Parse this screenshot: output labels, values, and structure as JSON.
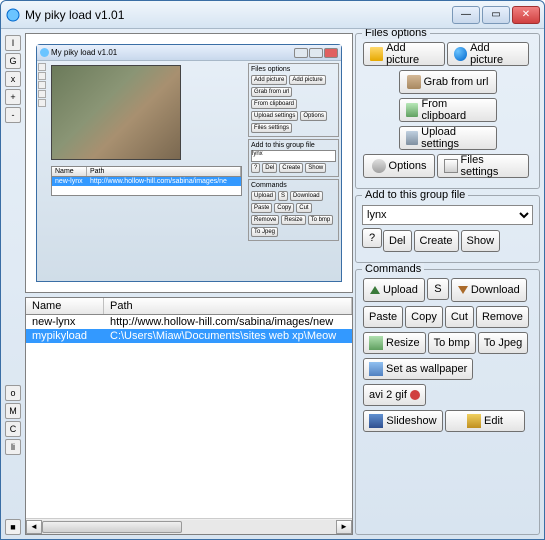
{
  "window": {
    "title": "My piky load v1.01"
  },
  "preview": {
    "title": "My piky load v1.01",
    "table": {
      "col_name": "Name",
      "col_path": "Path",
      "row_name": "new-lynx",
      "row_path": "http://www.hollow-hill.com/sabina/images/ne"
    },
    "groups": {
      "files": {
        "legend": "Files options",
        "add1": "Add picture",
        "add2": "Add picture",
        "grab": "Grab from url",
        "clip": "From clipboard",
        "upset": "Upload settings",
        "opts": "Options",
        "fset": "Files settings"
      },
      "addgroup": {
        "legend": "Add to this group file",
        "value": "lynx",
        "q": "?",
        "del": "Del",
        "create": "Create",
        "show": "Show"
      },
      "commands": {
        "legend": "Commands",
        "upload": "Upload",
        "s": "S",
        "download": "Download",
        "paste": "Paste",
        "copy": "Copy",
        "cut": "Cut",
        "remove": "Remove",
        "resize": "Resize",
        "tobmp": "To bmp",
        "tojpeg": "To Jpeg"
      }
    }
  },
  "table": {
    "col_name": "Name",
    "col_path": "Path",
    "rows": [
      {
        "name": "new-lynx",
        "path": "http://www.hollow-hill.com/sabina/images/new"
      },
      {
        "name": "mypikyload",
        "path": "C:\\Users\\Miaw\\Documents\\sites web xp\\Meow"
      }
    ]
  },
  "files": {
    "legend": "Files options",
    "add1": "Add picture",
    "add2": "Add picture",
    "grab": "Grab from url",
    "clip": "From clipboard",
    "upset": "Upload settings",
    "opts": "Options",
    "fset": "Files settings"
  },
  "addgroup": {
    "legend": "Add to this group file",
    "value": "lynx",
    "q": "?",
    "del": "Del",
    "create": "Create",
    "show": "Show"
  },
  "commands": {
    "legend": "Commands",
    "upload": "Upload",
    "s": "S",
    "download": "Download",
    "paste": "Paste",
    "copy": "Copy",
    "cut": "Cut",
    "remove": "Remove",
    "resize": "Resize",
    "tobmp": "To bmp",
    "tojpeg": "To Jpeg",
    "wallpaper": "Set as wallpaper",
    "avi2gif": "avi 2 gif",
    "slideshow": "Slideshow",
    "edit": "Edit"
  },
  "gutter": {
    "b1": "I",
    "b2": "G",
    "b3": "x",
    "b4": "+",
    "b5": "-",
    "b6": "o",
    "b7": "M",
    "b8": "C",
    "b9": "li",
    "b10": "■"
  }
}
